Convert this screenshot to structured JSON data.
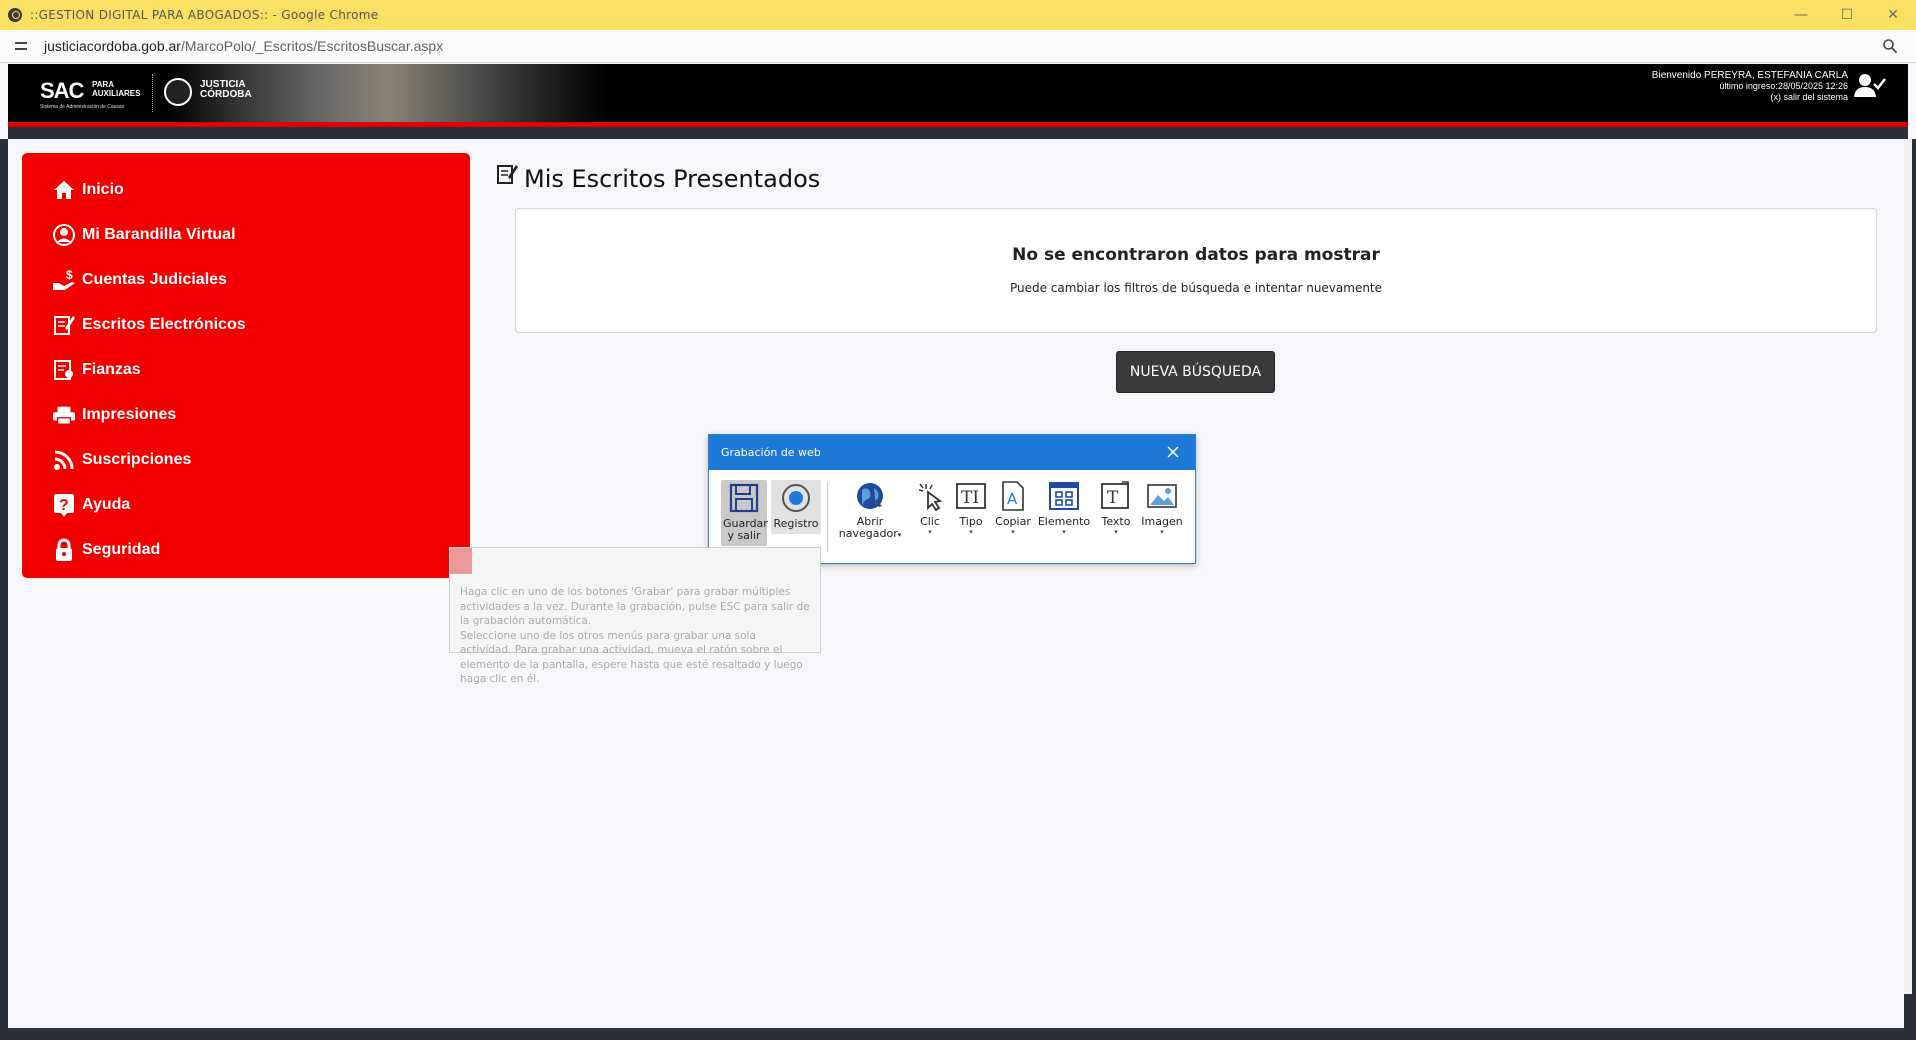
{
  "browser": {
    "title": "::GESTION   DIGITAL   PARA   ABOGADOS:: - Google Chrome",
    "url_domain": "justiciacordoba.gob.ar",
    "url_path": "/MarcoPolo/_Escritos/EscritosBuscar.aspx",
    "minimize": "—",
    "maximize": "☐",
    "close": "✕"
  },
  "header": {
    "logo_sac": "SAC",
    "logo_sac_sub1": "PARA",
    "logo_sac_sub2": "AUXILIARES",
    "logo_sac_tag": "Sistema de Administración de Causas",
    "logo_justicia1": "JUSTICIA",
    "logo_justicia2": "CÓRDOBA",
    "welcome": "Bienvenido PEREYRA, ESTEFANIA CARLA",
    "last_login": "último ingreso:28/05/2025 12:26",
    "logout": "(x) salir del sistema"
  },
  "sidebar": {
    "items": [
      {
        "label": "Inicio",
        "icon": "home-icon"
      },
      {
        "label": "Mi Barandilla Virtual",
        "icon": "user-circle-icon"
      },
      {
        "label": "Cuentas Judiciales",
        "icon": "hand-money-icon"
      },
      {
        "label": "Escritos Electrónicos",
        "icon": "edit-document-icon"
      },
      {
        "label": "Fianzas",
        "icon": "certificate-icon"
      },
      {
        "label": "Impresiones",
        "icon": "printer-icon"
      },
      {
        "label": "Suscripciones",
        "icon": "rss-icon"
      },
      {
        "label": "Ayuda",
        "icon": "question-icon"
      },
      {
        "label": "Seguridad",
        "icon": "lock-icon"
      }
    ]
  },
  "main": {
    "title": "Mis Escritos Presentados",
    "empty_heading": "No se encontraron datos para mostrar",
    "empty_text": "Puede cambiar los filtros de búsqueda e intentar nuevamente",
    "new_search": "NUEVA BÚSQUEDA"
  },
  "recorder": {
    "title": "Grabación de web",
    "tools": {
      "save": "Guardar\ny salir",
      "record": "Registro",
      "open_browser": "Abrir\nnavegador",
      "click": "Clic",
      "type": "Tipo",
      "copy": "Copiar",
      "element": "Elemento",
      "text": "Texto",
      "image": "Imagen"
    },
    "tooltip": "Haga clic en uno de los botones 'Grabar' para grabar múltiples actividades a la vez. Durante la grabación, pulse ESC para salir de la grabación automática.\n Seleccione uno de los otros menús para grabar una sola actividad. Para grabar una actividad, mueva el ratón sobre el elemento de la pantalla, espere hasta que esté resaltado y luego haga clic en él."
  },
  "colors": {
    "sidebar_bg": "#f20000",
    "title_bar": "#f9e063",
    "recorder_head": "#1e78d6",
    "button_dark": "#3a3a3a"
  }
}
